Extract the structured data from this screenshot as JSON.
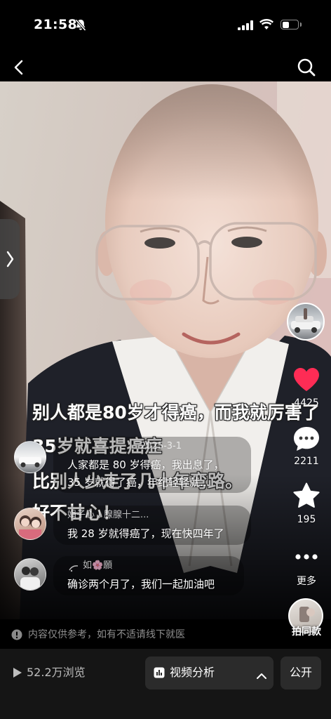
{
  "status_bar": {
    "time": "21:58",
    "battery_level": 0.45,
    "icons": [
      "bell-slash-icon",
      "signal-icon",
      "wifi-icon",
      "battery-icon"
    ]
  },
  "nav": {
    "icons": [
      "chevron-left-icon",
      "search-icon"
    ]
  },
  "video": {
    "captions": [
      "别人都是80岁才得癌，而我就厉害了",
      "35岁就喜提癌症",
      "比别人少走了几十年弯路。",
      "好不甘心！"
    ]
  },
  "side_tab": {
    "icon": "chevron-right-icon"
  },
  "actions": {
    "like_count": "4425",
    "comment_count": "2211",
    "favorite_count": "195",
    "more_label": "更多",
    "same_style_label": "拍同款",
    "like_color": "#fe2c55",
    "icons": [
      "heart-icon",
      "comment-icon",
      "star-icon",
      "more-icon"
    ]
  },
  "comments": [
    {
      "user": "2025-3-1",
      "lines": [
        "人家都是 80 岁得癌，我出息了，",
        "35 岁就得了癌，年纪轻轻就..."
      ]
    },
    {
      "user": "娟子心丨腺腺十二...",
      "lines": [
        "我 28 岁就得癌了，现在快四年了"
      ]
    },
    {
      "user": "如🌸願",
      "lines": [
        "确诊两个月了，我们一起加油吧"
      ]
    }
  ],
  "disclaimer": "内容仅供参考，如有不适请线下就医",
  "bottom_bar": {
    "views": "52.2万浏览",
    "analysis_label": "视频分析",
    "visibility_label": "公开",
    "icons": [
      "play-icon",
      "chart-icon",
      "chevron-up-icon"
    ]
  }
}
